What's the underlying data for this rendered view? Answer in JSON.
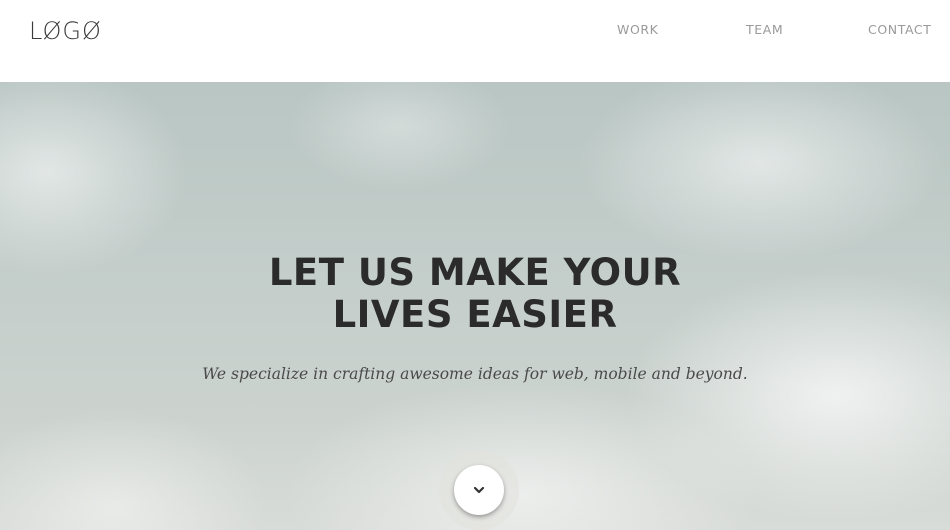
{
  "header": {
    "logo": "LØGØ",
    "nav": [
      {
        "label": "WORK"
      },
      {
        "label": "TEAM"
      },
      {
        "label": "CONTACT"
      }
    ]
  },
  "hero": {
    "title_line1": "LET US MAKE YOUR",
    "title_line2": "LIVES EASIER",
    "subtitle": "We specialize in crafting awesome ideas for web, mobile and beyond.",
    "scroll_icon": "chevron-down-icon"
  },
  "colors": {
    "nav_text": "#9a9a9a",
    "title_text": "#2b2b2b",
    "subtitle_text": "#4a4a4a"
  }
}
